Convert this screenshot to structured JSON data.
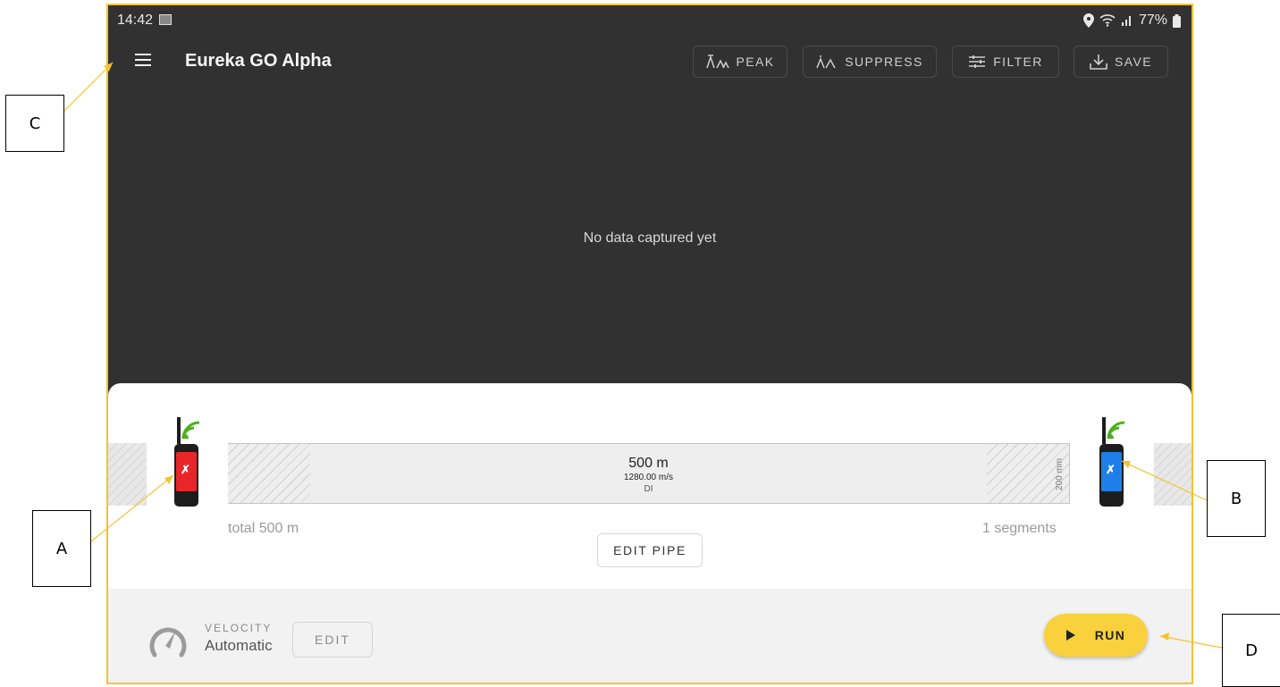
{
  "status_bar": {
    "time": "14:42",
    "battery": "77%"
  },
  "app_bar": {
    "title": "Eureka GO Alpha",
    "buttons": [
      {
        "label": "PEAK",
        "icon": "peak-icon"
      },
      {
        "label": "SUPPRESS",
        "icon": "suppress-icon"
      },
      {
        "label": "FILTER",
        "icon": "filter-icon"
      },
      {
        "label": "SAVE",
        "icon": "save-icon"
      }
    ]
  },
  "plot": {
    "empty_message": "No data captured yet"
  },
  "pipe": {
    "length": "500 m",
    "velocity": "1280.00 m/s",
    "material": "DI",
    "diameter": "200 mm",
    "total": "total 500 m",
    "segments": "1 segments",
    "edit_label": "EDIT PIPE",
    "sensor_a_color": "#e8262a",
    "sensor_b_color": "#1f7fe8",
    "signal_color": "#4caf1a"
  },
  "bottom": {
    "velocity_caption": "VELOCITY",
    "velocity_mode": "Automatic",
    "edit_label": "EDIT",
    "run_label": "RUN"
  },
  "callouts": {
    "a": "A",
    "b": "B",
    "c": "C",
    "d": "D"
  },
  "colors": {
    "accent": "#f9d13d",
    "border": "#f5c230",
    "dark_bg": "#313131"
  }
}
